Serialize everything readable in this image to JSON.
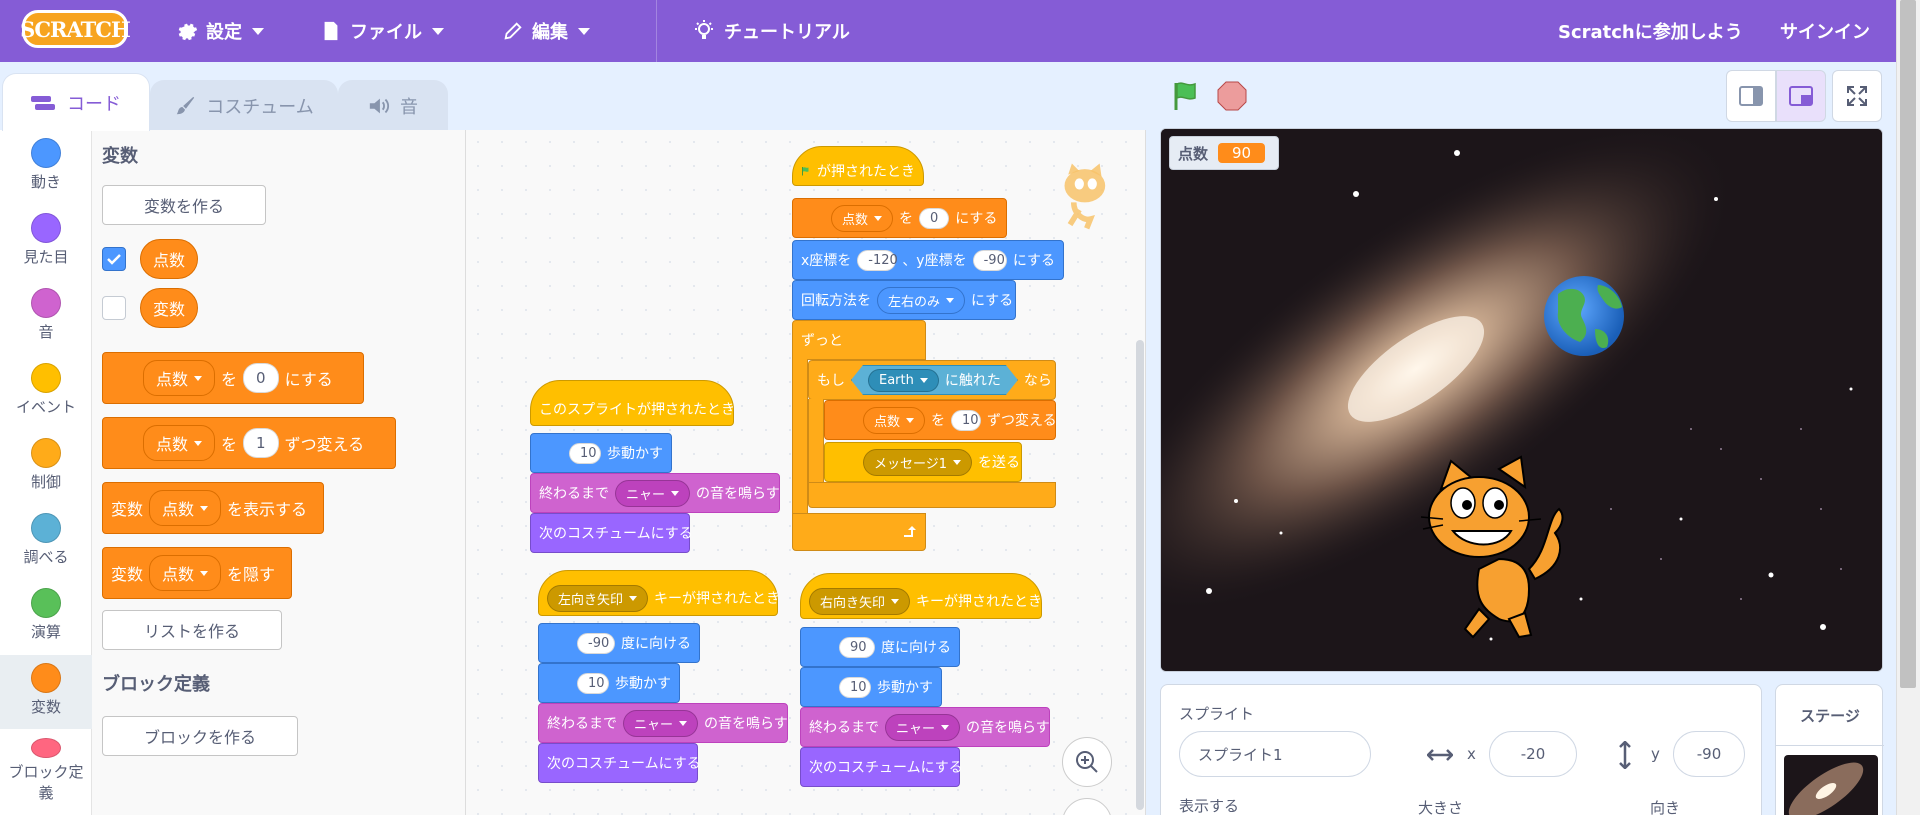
{
  "menu": {
    "logo_text": "SCRATCH",
    "settings": "設定",
    "file": "ファイル",
    "edit": "編集",
    "tutorial": "チュートリアル",
    "join": "Scratchに参加しよう",
    "signin": "サインイン"
  },
  "tabs": [
    "コード",
    "コスチューム",
    "音"
  ],
  "categories": [
    {
      "label": "動き",
      "color": "#4c97ff"
    },
    {
      "label": "見た目",
      "color": "#9966ff"
    },
    {
      "label": "音",
      "color": "#cf63cf"
    },
    {
      "label": "イベント",
      "color": "#ffbf00"
    },
    {
      "label": "制御",
      "color": "#ffab19"
    },
    {
      "label": "調べる",
      "color": "#5cb1d6"
    },
    {
      "label": "演算",
      "color": "#59c059"
    },
    {
      "label": "変数",
      "color": "#ff8c1a"
    },
    {
      "label": "ブロック定義",
      "color": "#ff6680"
    }
  ],
  "palette": {
    "variables_title": "変数",
    "make_variable": "変数を作る",
    "var1": "点数",
    "var2": "変数",
    "set_var": "点数",
    "set_word": "を",
    "set_value": "0",
    "set_end": "にする",
    "change_var": "点数",
    "change_word": "を",
    "change_value": "1",
    "change_end": "ずつ変える",
    "show_prefix": "変数",
    "show_var": "点数",
    "show_end": "を表示する",
    "hide_prefix": "変数",
    "hide_var": "点数",
    "hide_end": "を隠す",
    "make_list": "リストを作る",
    "blocks_title": "ブロック定義",
    "make_block": "ブロックを作る"
  },
  "scripts": {
    "flag_hat": "が押されたとき",
    "set_var": "点数",
    "set_word": "を",
    "set_val": "0",
    "set_end": "にする",
    "goto_x_label": "x座標を",
    "goto_x": "-120",
    "goto_y_label": "、y座標を",
    "goto_y": "-90",
    "goto_end": "にする",
    "rot_label": "回転方法を",
    "rot_val": "左右のみ",
    "rot_end": "にする",
    "forever": "ずっと",
    "if_label": "もし",
    "touch_target": "Earth",
    "touch_end": "に触れた",
    "then": "なら",
    "chg_var": "点数",
    "chg_word": "を",
    "chg_val": "10",
    "chg_end": "ずつ変える",
    "broadcast_msg": "メッセージ1",
    "broadcast_end": "を送る",
    "click_hat": "このスプライトが押されたとき",
    "move1_val": "10",
    "move1_end": "歩動かす",
    "sound1_label": "終わるまで",
    "sound1_val": "ニャー",
    "sound1_end": "の音を鳴らす",
    "costume1": "次のコスチュームにする",
    "left_key": "左向き矢印",
    "key_end": "キーが押されたとき",
    "dir_left": "-90",
    "dir_end": "度に向ける",
    "move2_val": "10",
    "move2_end": "歩動かす",
    "sound2_label": "終わるまで",
    "sound2_val": "ニャー",
    "sound2_end": "の音を鳴らす",
    "costume2": "次のコスチュームにする",
    "right_key": "右向き矢印",
    "key_end2": "キーが押されたとき",
    "dir_right": "90",
    "dir_end2": "度に向ける",
    "move3_val": "10",
    "move3_end": "歩動かす",
    "sound3_label": "終わるまで",
    "sound3_val": "ニャー",
    "sound3_end": "の音を鳴らす",
    "costume3": "次のコスチュームにする"
  },
  "stage": {
    "monitor_label": "点数",
    "monitor_value": "90"
  },
  "sprite_info": {
    "title": "スプライト",
    "name": "スプライト1",
    "x_label": "x",
    "x": "-20",
    "y_label": "y",
    "y": "-90",
    "show_label": "表示する",
    "size_label": "大きさ",
    "dir_label": "向き"
  },
  "stage_panel": {
    "title": "ステージ"
  }
}
